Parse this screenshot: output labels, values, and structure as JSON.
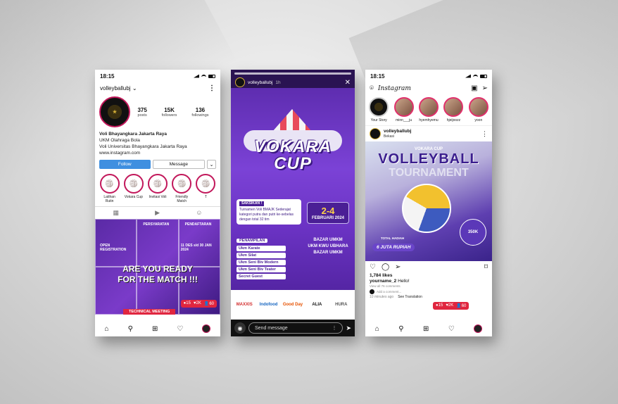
{
  "profile_phone": {
    "time": "18:15",
    "username": "volleyballubj",
    "stats": [
      {
        "num": "375",
        "label": "posts"
      },
      {
        "num": "15K",
        "label": "followers"
      },
      {
        "num": "136",
        "label": "followings"
      }
    ],
    "bio": {
      "name": "Voli Bhayangkara Jakarta Raya",
      "line1": "UKM Olahraga Bola",
      "line2": "Voli Universitas Bhayangkara Jakarta Raya",
      "link": "www.instagram.com"
    },
    "follow_label": "Follow",
    "message_label": "Message",
    "highlights": [
      "Latihan Rutin",
      "Vokara Cup",
      "Invitasi Voli",
      "Friendly Match",
      "T"
    ],
    "grid_tags": [
      "PERSYARATAN",
      "PENDAFTARAN",
      "OPEN REGISTRATION",
      "11 DES s/d 30 JAN 2024",
      "TECHNICAL MEETING"
    ],
    "ready_line1": "ARE YOU READY",
    "ready_line2": "FOR THE MATCH !!!",
    "notif": {
      "likes": "15",
      "follows": "2K",
      "comments": "60"
    }
  },
  "story_phone": {
    "username": "volleyballubj",
    "age": "1h",
    "title": "VOKARA CUP",
    "saksikan_header": "SAKSIKAN !",
    "saksikan_text": "Turnamen Voli BMAJK Sederajat kategori putra dan putri ke-sebelas dengan total 32 tim",
    "date_range": "2-4",
    "date_sub": "FEBRUARI 2024",
    "right_list": [
      "BAZAR UMKM",
      "UKM KWU UBHARA",
      "BAZAR UMKM"
    ],
    "penampilan_header": "PENAMPILAN",
    "penampilan": [
      "Ukm Karate",
      "Ukm Silat",
      "Ukm Seni Biv Modern",
      "Ukm Seni Biv Teater",
      "Secret Guest"
    ],
    "sponsors": [
      "MAXXIS",
      "Indofood",
      "Good Day",
      "ALIA",
      "HURA"
    ],
    "send_placeholder": "Send message"
  },
  "feed_phone": {
    "time": "18:15",
    "app_title": "Instagram",
    "stories": [
      "Your Story",
      "minn___ju",
      "hyemhyemu",
      "hjeijoozz",
      "yoon"
    ],
    "post_user": "volleyballubj",
    "post_location": "Bekasi",
    "post_cup": "VOKARA CUP",
    "post_title": "VOLLEYBALL",
    "post_subtitle": "TOURNAMENT",
    "total_hadiah": "TOTAL HADIAH",
    "prize": "6 JUTA RUPIAH",
    "badge": "350K",
    "likes": "1,784 likes",
    "comment_user": "yourname_2",
    "comment_text": "Hello!",
    "view_comments": "View all 76 comments",
    "add_comment": "Add a comment...",
    "time_ago": "10 minutes ago",
    "see_translation": "See Translation",
    "notif": {
      "likes": "15",
      "follows": "2K",
      "comments": "60"
    }
  },
  "colors": {
    "accent": "#e0263f",
    "purple": "#5e2db0",
    "follow_blue": "#3f8fe0"
  }
}
